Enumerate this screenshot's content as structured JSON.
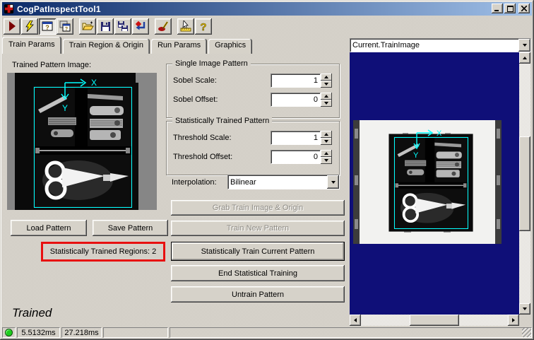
{
  "window": {
    "title": "CogPatInspectTool1",
    "icons": [
      "app-cross-icon",
      "minimize-icon",
      "maximize-icon",
      "close-icon"
    ]
  },
  "toolbar": {
    "icons": [
      "play-icon",
      "lightning-icon",
      "tool-window-icon",
      "tool-window-copy-icon",
      "open-folder-icon",
      "save-floppy-icon",
      "save-as-floppy-icon",
      "reset-arrow-icon",
      "paintbrush-icon",
      "pointer-ruler-icon",
      "help-icon"
    ]
  },
  "tabs": {
    "items": [
      {
        "label": "Train Params",
        "active": true
      },
      {
        "label": "Train Region & Origin",
        "active": false
      },
      {
        "label": "Run Params",
        "active": false
      },
      {
        "label": "Graphics",
        "active": false
      }
    ]
  },
  "left_panel": {
    "image_label": "Trained Pattern Image:",
    "load_button": "Load Pattern",
    "save_button": "Save Pattern",
    "regions_text": "Statistically Trained Regions: 2",
    "state_text": "Trained"
  },
  "param_panel": {
    "groups": [
      {
        "title": "Single Image Pattern",
        "fields": [
          {
            "label": "Sobel Scale:",
            "value": "1"
          },
          {
            "label": "Sobel Offset:",
            "value": "0"
          }
        ]
      },
      {
        "title": "Statistically Trained Pattern",
        "fields": [
          {
            "label": "Threshold Scale:",
            "value": "1"
          },
          {
            "label": "Threshold Offset:",
            "value": "0"
          }
        ]
      }
    ],
    "interpolation": {
      "label": "Interpolation:",
      "value": "Bilinear"
    },
    "action_buttons": [
      {
        "label": "Grab Train Image & Origin",
        "enabled": false
      },
      {
        "label": "Train New Pattern",
        "enabled": false
      },
      {
        "label": "Statistically Train Current Pattern",
        "enabled": true
      },
      {
        "label": "End Statistical Training",
        "enabled": true
      },
      {
        "label": "Untrain Pattern",
        "enabled": true
      }
    ]
  },
  "image_panel": {
    "source_value": "Current.TrainImage",
    "overlay": {
      "x_label": "X",
      "y_label": "Y"
    }
  },
  "statusbar": {
    "led_icon": "green-led-icon",
    "timer1": "5.5132ms",
    "timer2": "27.218ms"
  },
  "colors": {
    "titlebar_left": "#0b2a68",
    "titlebar_right": "#a0c0e8",
    "display_background": "#0f0f78",
    "overlay_cyan": "#00ffff",
    "annotation_red": "#e81010",
    "led_green": "#1ecc1e"
  }
}
